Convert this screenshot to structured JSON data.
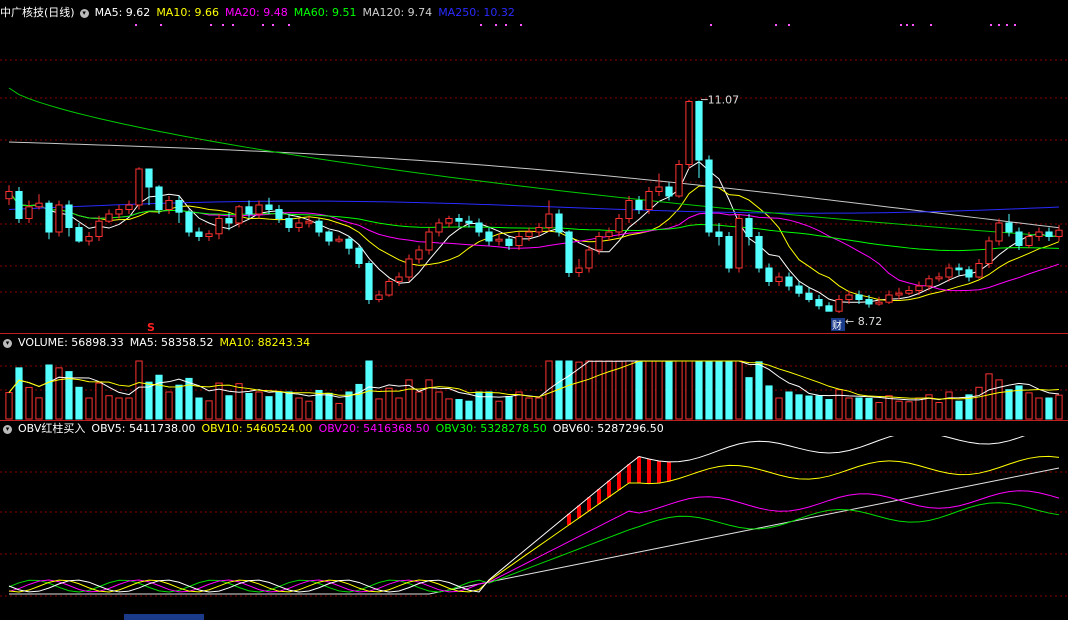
{
  "main": {
    "title": "中广核技(日线)",
    "indicators": [
      {
        "label": "MA5: 9.62",
        "color": "#ffffff"
      },
      {
        "label": "MA10: 9.66",
        "color": "#ffff00"
      },
      {
        "label": "MA20: 9.48",
        "color": "#ff00ff"
      },
      {
        "label": "MA60: 9.51",
        "color": "#00ff00"
      },
      {
        "label": "MA120: 9.74",
        "color": "#d0d0d0"
      },
      {
        "label": "MA250: 10.32",
        "color": "#2a2aff"
      }
    ],
    "high_label": "11.07",
    "low_label": "8.72",
    "marker_s": "S",
    "marker_cai": "财"
  },
  "volume": {
    "indicators": [
      {
        "label": "VOLUME: 56898.33",
        "color": "#ffffff"
      },
      {
        "label": "MA5: 58358.52",
        "color": "#ffffff"
      },
      {
        "label": "MA10: 88243.34",
        "color": "#ffff00"
      }
    ]
  },
  "obv": {
    "indicators": [
      {
        "label": "OBV红柱买入",
        "color": "#ffffff"
      },
      {
        "label": "OBV5: 5411738.00",
        "color": "#ffffff"
      },
      {
        "label": "OBV10: 5460524.00",
        "color": "#ffff00"
      },
      {
        "label": "OBV20: 5416368.50",
        "color": "#ff00ff"
      },
      {
        "label": "OBV30: 5328278.50",
        "color": "#00ff00"
      },
      {
        "label": "OBV60: 5287296.50",
        "color": "#ffffff"
      }
    ]
  },
  "colors": {
    "up": "#ff3232",
    "down": "#54ffff",
    "grid": "#8b0000"
  },
  "chart_data": {
    "type": "candlestick",
    "price_range": [
      8.6,
      11.2
    ],
    "candles": [
      [
        9.97,
        10.05,
        9.9,
        10.12
      ],
      [
        10.05,
        9.75,
        9.7,
        10.1
      ],
      [
        9.75,
        9.88,
        9.7,
        9.95
      ],
      [
        9.88,
        9.92,
        9.85,
        10.02
      ],
      [
        9.92,
        9.6,
        9.52,
        9.95
      ],
      [
        9.6,
        9.9,
        9.55,
        9.95
      ],
      [
        9.9,
        9.65,
        9.55,
        9.95
      ],
      [
        9.65,
        9.5,
        9.48,
        9.7
      ],
      [
        9.5,
        9.55,
        9.45,
        9.6
      ],
      [
        9.55,
        9.72,
        9.5,
        9.78
      ],
      [
        9.72,
        9.8,
        9.7,
        9.85
      ],
      [
        9.8,
        9.85,
        9.75,
        9.9
      ],
      [
        9.85,
        9.9,
        9.8,
        9.95
      ],
      [
        9.9,
        10.3,
        9.85,
        10.32
      ],
      [
        10.3,
        10.1,
        9.9,
        10.15
      ],
      [
        10.1,
        9.85,
        9.8,
        10.12
      ],
      [
        9.85,
        9.95,
        9.8,
        10.0
      ],
      [
        9.95,
        9.82,
        9.7,
        10.0
      ],
      [
        9.82,
        9.6,
        9.55,
        9.85
      ],
      [
        9.6,
        9.55,
        9.5,
        9.65
      ],
      [
        9.55,
        9.58,
        9.5,
        9.62
      ],
      [
        9.58,
        9.75,
        9.52,
        9.8
      ],
      [
        9.75,
        9.7,
        9.62,
        9.82
      ],
      [
        9.7,
        9.88,
        9.65,
        9.9
      ],
      [
        9.88,
        9.8,
        9.75,
        9.95
      ],
      [
        9.8,
        9.9,
        9.75,
        9.95
      ],
      [
        9.9,
        9.85,
        9.8,
        9.98
      ],
      [
        9.85,
        9.75,
        9.7,
        9.9
      ],
      [
        9.75,
        9.65,
        9.6,
        9.8
      ],
      [
        9.65,
        9.7,
        9.6,
        9.75
      ],
      [
        9.7,
        9.72,
        9.65,
        9.78
      ],
      [
        9.72,
        9.6,
        9.55,
        9.75
      ],
      [
        9.6,
        9.5,
        9.45,
        9.62
      ],
      [
        9.5,
        9.52,
        9.48,
        9.56
      ],
      [
        9.52,
        9.42,
        9.35,
        9.55
      ],
      [
        9.42,
        9.25,
        9.2,
        9.45
      ],
      [
        9.25,
        8.85,
        8.8,
        9.28
      ],
      [
        8.85,
        8.9,
        8.82,
        8.95
      ],
      [
        8.9,
        9.05,
        8.88,
        9.08
      ],
      [
        9.05,
        9.1,
        9.0,
        9.15
      ],
      [
        9.1,
        9.3,
        9.05,
        9.35
      ],
      [
        9.3,
        9.4,
        9.25,
        9.45
      ],
      [
        9.4,
        9.6,
        9.35,
        9.65
      ],
      [
        9.6,
        9.7,
        9.55,
        9.75
      ],
      [
        9.7,
        9.75,
        9.65,
        9.78
      ],
      [
        9.75,
        9.72,
        9.65,
        9.8
      ],
      [
        9.72,
        9.7,
        9.65,
        9.78
      ],
      [
        9.7,
        9.6,
        9.55,
        9.75
      ],
      [
        9.6,
        9.5,
        9.45,
        9.65
      ],
      [
        9.5,
        9.52,
        9.45,
        9.58
      ],
      [
        9.52,
        9.45,
        9.4,
        9.55
      ],
      [
        9.45,
        9.55,
        9.4,
        9.6
      ],
      [
        9.55,
        9.6,
        9.5,
        9.65
      ],
      [
        9.6,
        9.65,
        9.55,
        9.7
      ],
      [
        9.65,
        9.8,
        9.6,
        9.95
      ],
      [
        9.8,
        9.6,
        9.55,
        9.85
      ],
      [
        9.6,
        9.15,
        9.1,
        9.62
      ],
      [
        9.15,
        9.2,
        9.1,
        9.3
      ],
      [
        9.2,
        9.4,
        9.15,
        9.45
      ],
      [
        9.4,
        9.55,
        9.35,
        9.6
      ],
      [
        9.55,
        9.6,
        9.5,
        9.65
      ],
      [
        9.6,
        9.75,
        9.55,
        9.8
      ],
      [
        9.75,
        9.95,
        9.7,
        10.0
      ],
      [
        9.95,
        9.85,
        9.8,
        10.0
      ],
      [
        9.85,
        10.05,
        9.8,
        10.1
      ],
      [
        10.05,
        10.1,
        10.0,
        10.25
      ],
      [
        10.1,
        10.0,
        9.95,
        10.15
      ],
      [
        10.0,
        10.35,
        9.98,
        10.4
      ],
      [
        10.35,
        11.05,
        10.3,
        11.07
      ],
      [
        11.05,
        10.4,
        10.2,
        11.06
      ],
      [
        10.4,
        9.6,
        9.55,
        10.45
      ],
      [
        9.6,
        9.55,
        9.45,
        9.7
      ],
      [
        9.55,
        9.2,
        9.15,
        9.6
      ],
      [
        9.2,
        9.75,
        9.15,
        9.8
      ],
      [
        9.75,
        9.55,
        9.45,
        9.8
      ],
      [
        9.55,
        9.2,
        9.15,
        9.6
      ],
      [
        9.2,
        9.05,
        9.0,
        9.25
      ],
      [
        9.05,
        9.1,
        9.0,
        9.15
      ],
      [
        9.1,
        9.0,
        8.95,
        9.15
      ],
      [
        9.0,
        8.92,
        8.88,
        9.05
      ],
      [
        8.92,
        8.85,
        8.82,
        8.98
      ],
      [
        8.85,
        8.78,
        8.74,
        8.9
      ],
      [
        8.78,
        8.72,
        8.72,
        8.82
      ],
      [
        8.72,
        8.85,
        8.7,
        8.9
      ],
      [
        8.85,
        8.9,
        8.8,
        8.95
      ],
      [
        8.9,
        8.85,
        8.8,
        8.95
      ],
      [
        8.85,
        8.8,
        8.76,
        8.9
      ],
      [
        8.8,
        8.82,
        8.78,
        8.88
      ],
      [
        8.82,
        8.9,
        8.8,
        8.95
      ],
      [
        8.9,
        8.92,
        8.85,
        8.98
      ],
      [
        8.92,
        8.95,
        8.9,
        9.0
      ],
      [
        8.95,
        9.0,
        8.9,
        9.05
      ],
      [
        9.0,
        9.08,
        8.95,
        9.12
      ],
      [
        9.08,
        9.1,
        9.05,
        9.15
      ],
      [
        9.1,
        9.2,
        9.05,
        9.25
      ],
      [
        9.2,
        9.18,
        9.12,
        9.25
      ],
      [
        9.18,
        9.1,
        9.05,
        9.22
      ],
      [
        9.1,
        9.25,
        9.08,
        9.3
      ],
      [
        9.25,
        9.5,
        9.2,
        9.55
      ],
      [
        9.5,
        9.7,
        9.45,
        9.75
      ],
      [
        9.7,
        9.6,
        9.55,
        9.8
      ],
      [
        9.6,
        9.45,
        9.4,
        9.65
      ],
      [
        9.45,
        9.55,
        9.42,
        9.6
      ],
      [
        9.55,
        9.6,
        9.5,
        9.65
      ],
      [
        9.6,
        9.55,
        9.5,
        9.65
      ],
      [
        9.55,
        9.62,
        9.5,
        9.68
      ]
    ]
  }
}
